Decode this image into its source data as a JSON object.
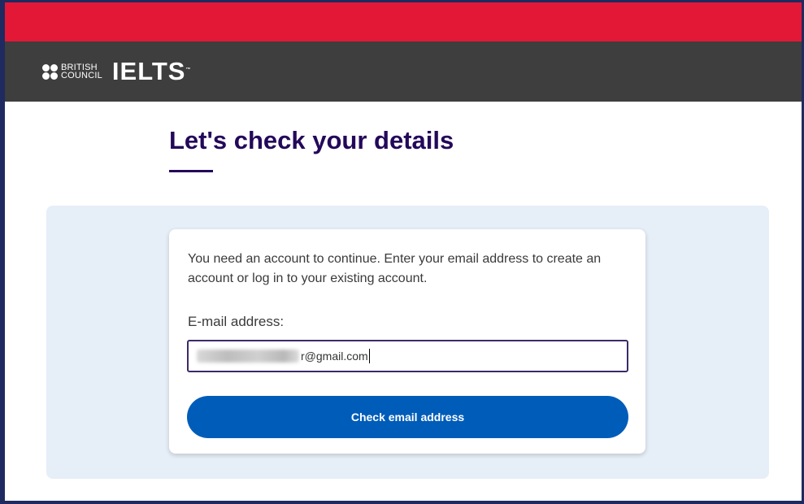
{
  "brand": {
    "council_line1": "BRITISH",
    "council_line2": "COUNCIL",
    "product": "IELTS",
    "trademark": "™"
  },
  "page": {
    "title": "Let's check your details"
  },
  "form": {
    "intro": "You need an account to continue. Enter your email address to create an account or log in to your existing account.",
    "email_label": "E-mail address:",
    "email_value_visible": "r@gmail.com",
    "submit_label": "Check email address"
  },
  "colors": {
    "top_bar": "#e31837",
    "header": "#3e3e3e",
    "title": "#23085a",
    "panel": "#e6eef8",
    "button": "#005cb9"
  }
}
